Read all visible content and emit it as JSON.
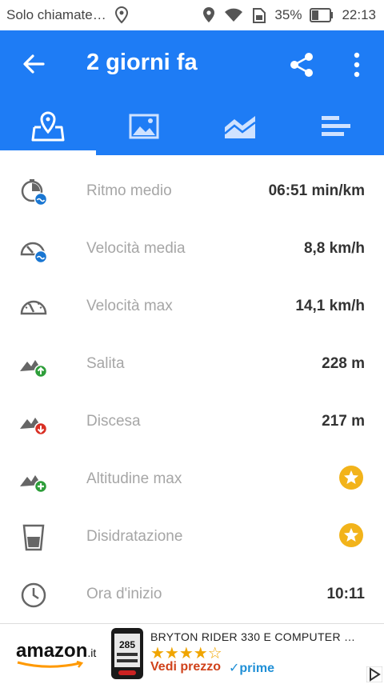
{
  "status_bar": {
    "carrier_text": "Solo chiamate…",
    "battery_percent": "35%",
    "time": "22:13",
    "icons": [
      "location-icon",
      "location-icon",
      "wifi-icon",
      "sim-icon",
      "battery-icon"
    ]
  },
  "app_bar": {
    "title": "2 giorni fa",
    "icons": [
      "back-arrow-icon",
      "share-icon",
      "more-vert-icon"
    ]
  },
  "tabs": [
    {
      "name": "map-tab",
      "icon": "map-pin-icon",
      "selected": true
    },
    {
      "name": "photos-tab",
      "icon": "image-icon",
      "selected": false
    },
    {
      "name": "chart-tab",
      "icon": "area-chart-icon",
      "selected": false
    },
    {
      "name": "stats-tab",
      "icon": "bars-icon",
      "selected": false
    }
  ],
  "stats": {
    "rows": [
      {
        "icon": "pace-icon",
        "label": "Ritmo medio",
        "value": "06:51 min/km"
      },
      {
        "icon": "avg-speed-icon",
        "label": "Velocità media",
        "value": "8,8 km/h"
      },
      {
        "icon": "max-speed-icon",
        "label": "Velocità max",
        "value": "14,1 km/h"
      },
      {
        "icon": "ascent-icon",
        "label": "Salita",
        "value": "228 m"
      },
      {
        "icon": "descent-icon",
        "label": "Discesa",
        "value": "217 m"
      },
      {
        "icon": "max-altitude-icon",
        "label": "Altitudine max",
        "value": "",
        "premium": true
      },
      {
        "icon": "hydration-icon",
        "label": "Disidratazione",
        "value": "",
        "premium": true
      },
      {
        "icon": "clock-icon",
        "label": "Ora d'inizio",
        "value": "10:11"
      }
    ]
  },
  "ad": {
    "brand": "amazon",
    "brand_suffix": ".it",
    "product_title": "BRYTON RIDER 330 E COMPUTER …",
    "rating_stars": 4,
    "cta": "Vedi prezzo",
    "prime": "✓prime",
    "device_screen": "285"
  },
  "colors": {
    "primary": "#1e7cf5",
    "label_gray": "#a6a6a6",
    "value_dark": "#333333",
    "premium_star": "#f2b31a"
  }
}
